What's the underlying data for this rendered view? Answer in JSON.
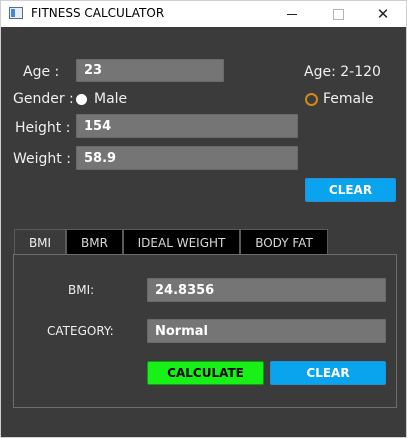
{
  "window": {
    "title": "FITNESS CALCULATOR"
  },
  "form": {
    "age_label": "Age :",
    "age_value": "23",
    "age_range_hint": "Age: 2-120",
    "gender_label": "Gender :",
    "gender_options": [
      "Male",
      "Female"
    ],
    "gender_selected": "Male",
    "height_label": "Height :",
    "height_value": "154",
    "weight_label": "Weight :",
    "weight_value": "58.9",
    "clear_label": "CLEAR"
  },
  "tabs": [
    {
      "label": "BMI",
      "active": true
    },
    {
      "label": "BMR",
      "active": false
    },
    {
      "label": "IDEAL WEIGHT",
      "active": false
    },
    {
      "label": "BODY FAT",
      "active": false
    }
  ],
  "bmi_panel": {
    "bmi_label": "BMI:",
    "bmi_value": "24.8356",
    "category_label": "CATEGORY:",
    "category_value": "Normal",
    "calculate_label": "CALCULATE",
    "clear_label": "CLEAR"
  },
  "colors": {
    "background": "#3b3b3b",
    "field_bg": "#757575",
    "clear_button": "#0aa3ee",
    "calculate_button": "#17f117",
    "radio_unchecked": "#d08a19"
  },
  "icons": [
    "app-icon",
    "minimize-icon",
    "maximize-icon",
    "close-icon"
  ]
}
